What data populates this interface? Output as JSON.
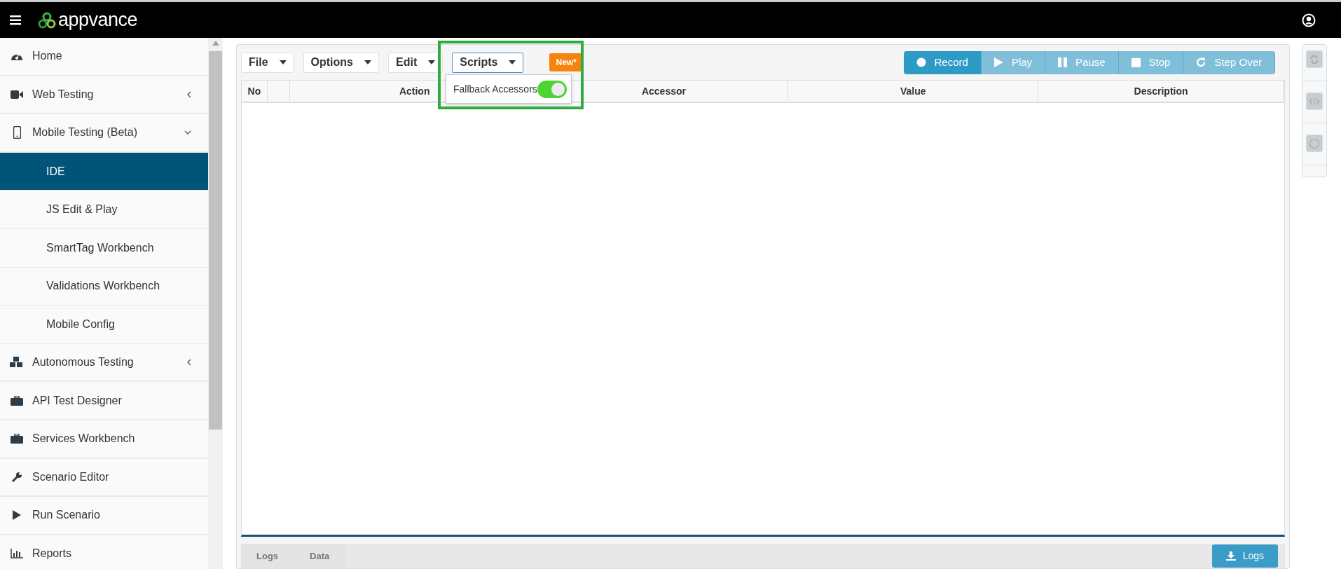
{
  "app": {
    "title": "appvance"
  },
  "sidebar": {
    "items": [
      {
        "label": "Home",
        "selected": false
      },
      {
        "label": "Web Testing",
        "selected": false,
        "expanded": false
      },
      {
        "label": "Mobile Testing (Beta)",
        "selected": false,
        "expanded": true,
        "children": [
          {
            "label": "IDE",
            "selected": true
          },
          {
            "label": "JS Edit & Play",
            "selected": false
          },
          {
            "label": "SmartTag Workbench",
            "selected": false
          },
          {
            "label": "Validations Workbench",
            "selected": false
          },
          {
            "label": "Mobile Config",
            "selected": false
          }
        ]
      },
      {
        "label": "Autonomous Testing",
        "selected": false,
        "expanded": false
      },
      {
        "label": "API Test Designer",
        "selected": false
      },
      {
        "label": "Services Workbench",
        "selected": false
      },
      {
        "label": "Scenario Editor",
        "selected": false
      },
      {
        "label": "Run Scenario",
        "selected": false
      },
      {
        "label": "Reports",
        "selected": false
      }
    ]
  },
  "toolbar": {
    "menus": [
      {
        "label": "File",
        "open": false
      },
      {
        "label": "Options",
        "open": false
      },
      {
        "label": "Edit",
        "open": false
      },
      {
        "label": "Scripts",
        "open": true
      }
    ],
    "badge": "New*",
    "dropdown": {
      "items": [
        {
          "label": "Fallback Accessors",
          "on": true
        }
      ]
    },
    "controls": [
      {
        "label": "Record",
        "disabled": false
      },
      {
        "label": "Play",
        "disabled": true
      },
      {
        "label": "Pause",
        "disabled": true
      },
      {
        "label": "Stop",
        "disabled": true
      },
      {
        "label": "Step Over",
        "disabled": true
      }
    ]
  },
  "table": {
    "columns": [
      "No",
      "Action",
      "Accessor",
      "Value",
      "Description"
    ]
  },
  "bottom_bar": {
    "tabs": [
      "Logs",
      "Data"
    ],
    "button": "Logs"
  }
}
